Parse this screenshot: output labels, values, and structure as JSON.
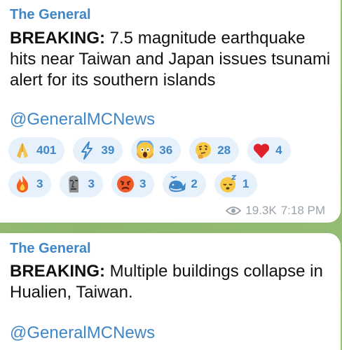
{
  "posts": [
    {
      "sender": "The General",
      "bold": "BREAKING:",
      "body": " 7.5 magnitude earthquake hits near Taiwan and Japan issues tsunami alert for its southern islands",
      "handle": "@GeneralMCNews",
      "reactions": [
        {
          "icon": "folded-hands-icon",
          "count": "401"
        },
        {
          "icon": "lightning-icon",
          "count": "39"
        },
        {
          "icon": "screaming-face-icon",
          "count": "36"
        },
        {
          "icon": "thinking-face-icon",
          "count": "28"
        },
        {
          "icon": "red-heart-icon",
          "count": "4"
        },
        {
          "icon": "fire-icon",
          "count": "3"
        },
        {
          "icon": "moai-icon",
          "count": "3"
        },
        {
          "icon": "angry-face-icon",
          "count": "3"
        },
        {
          "icon": "whale-icon",
          "count": "2"
        },
        {
          "icon": "sleeping-face-icon",
          "count": "1"
        }
      ],
      "views": "19.3K",
      "time": "7:18 PM"
    },
    {
      "sender": "The General",
      "bold": "BREAKING:",
      "body": " Multiple buildings collapse in Hualien, Taiwan.",
      "handle": "@GeneralMCNews"
    }
  ],
  "colors": {
    "accent": "#3f86c7",
    "pill_bg": "#e7f1fb",
    "meta": "#9aa3ab",
    "chat_bg": "#9cc07a"
  }
}
